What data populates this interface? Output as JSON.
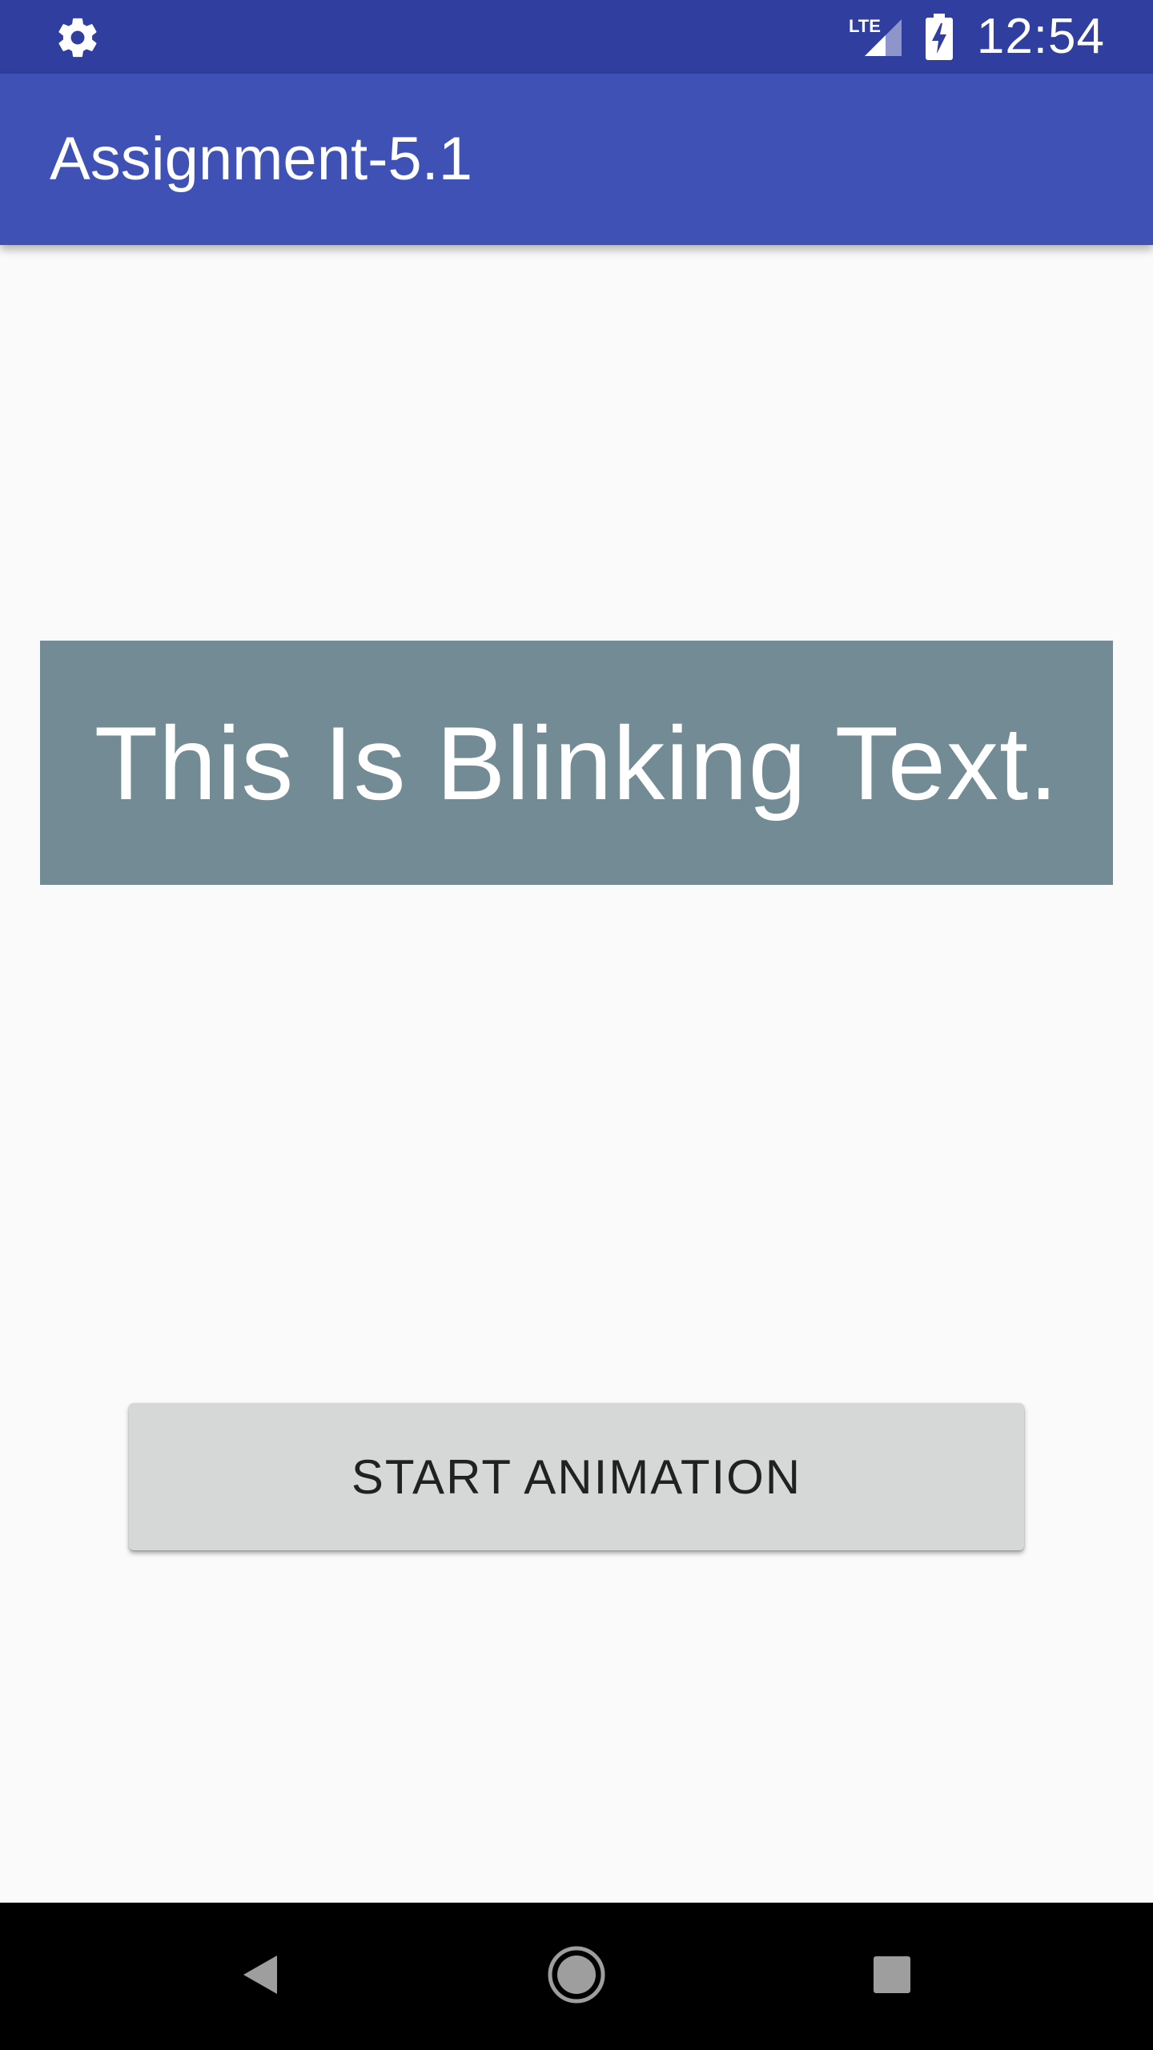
{
  "status_bar": {
    "left_icon": "gear-icon",
    "network_label": "LTE",
    "signal_icon": "cell-signal-icon",
    "battery_icon": "battery-charging-icon",
    "time": "12:54"
  },
  "app_bar": {
    "title": "Assignment-5.1"
  },
  "main": {
    "blink_text": "This Is Blinking Text.",
    "blink_box_color": "#738b94",
    "button_label": "START ANIMATION"
  },
  "nav_bar": {
    "back_icon": "back-triangle-icon",
    "home_icon": "home-circle-icon",
    "recents_icon": "recents-square-icon"
  },
  "colors": {
    "status_bar": "#303f9f",
    "app_bar": "#3f51b5",
    "background": "#fafafa",
    "button": "#d6d7d7"
  }
}
